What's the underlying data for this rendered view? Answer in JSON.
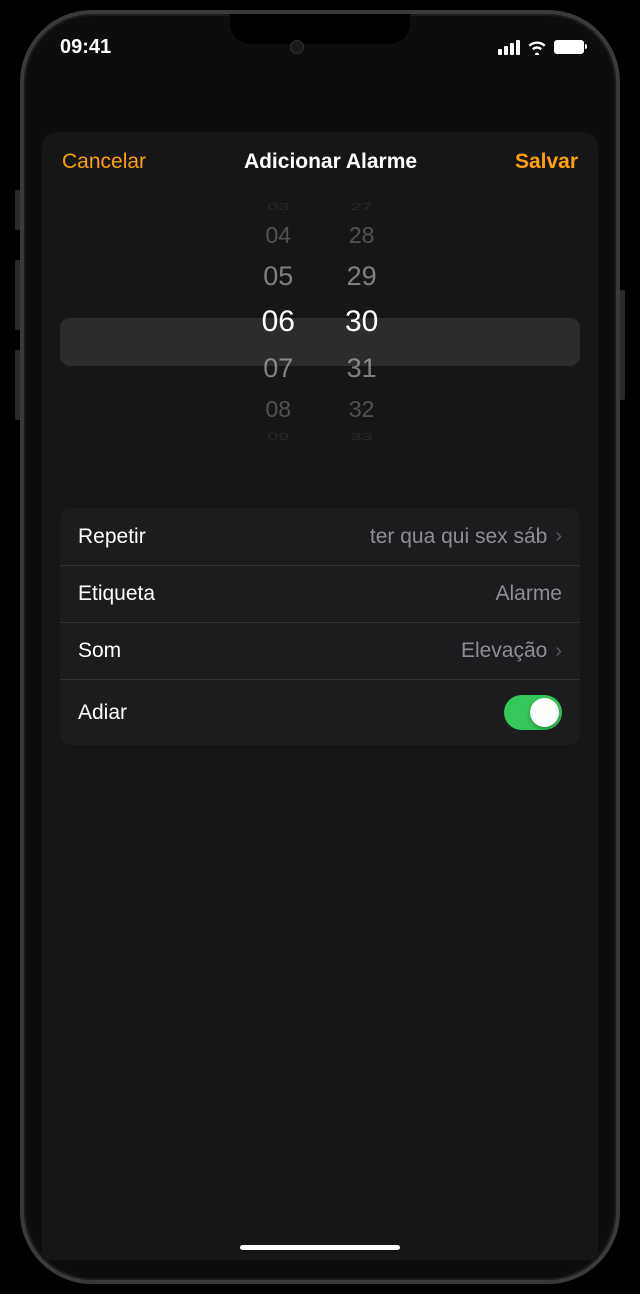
{
  "status": {
    "time": "09:41"
  },
  "nav": {
    "cancel": "Cancelar",
    "title": "Adicionar Alarme",
    "save": "Salvar"
  },
  "picker": {
    "hours": [
      "03",
      "04",
      "05",
      "06",
      "07",
      "08",
      "09"
    ],
    "minutes": [
      "27",
      "28",
      "29",
      "30",
      "31",
      "32",
      "33"
    ]
  },
  "rows": {
    "repeat": {
      "label": "Repetir",
      "value": "ter qua qui sex sáb"
    },
    "tag": {
      "label": "Etiqueta",
      "value": "Alarme"
    },
    "sound": {
      "label": "Som",
      "value": "Elevação"
    },
    "snooze": {
      "label": "Adiar"
    }
  }
}
